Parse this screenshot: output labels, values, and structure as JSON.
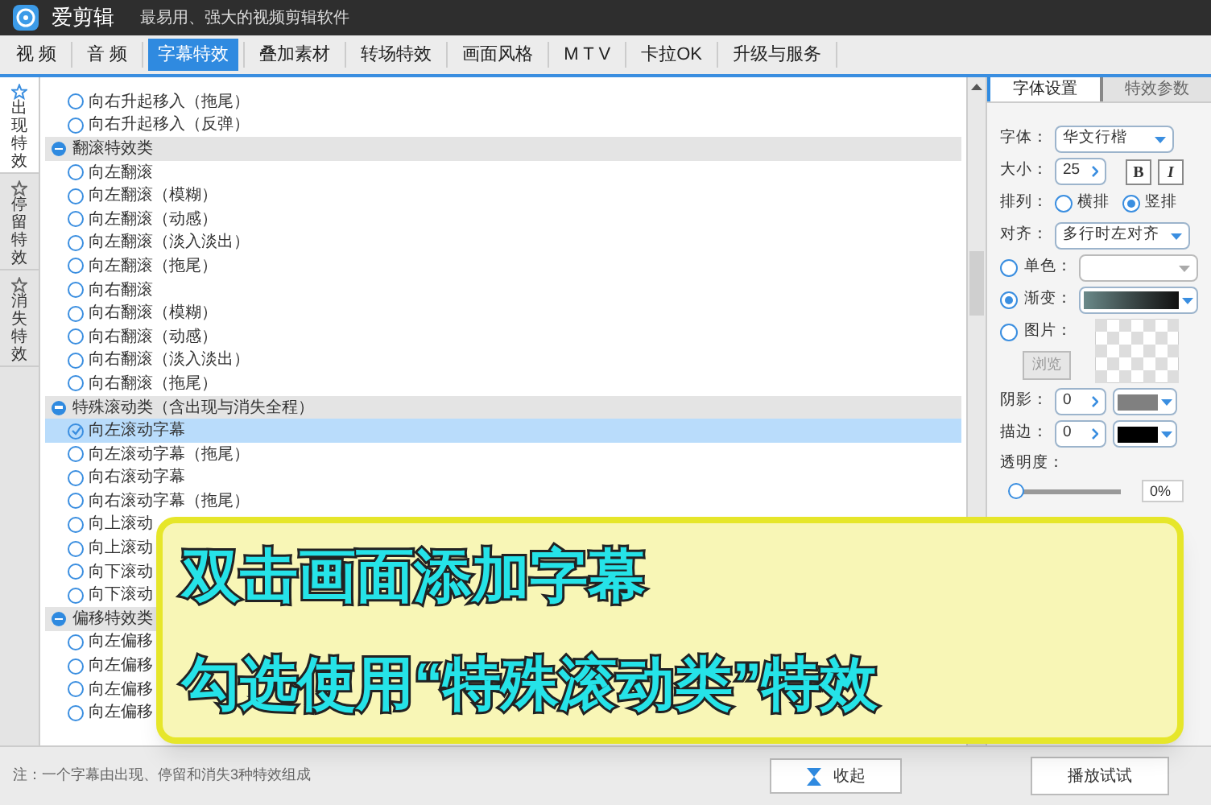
{
  "app": {
    "name": "爱剪辑",
    "slogan": "最易用、强大的视频剪辑软件"
  },
  "tabs": [
    {
      "label": "视 频",
      "selected": false
    },
    {
      "label": "音 频",
      "selected": false
    },
    {
      "label": "字幕特效",
      "selected": true
    },
    {
      "label": "叠加素材",
      "selected": false
    },
    {
      "label": "转场特效",
      "selected": false
    },
    {
      "label": "画面风格",
      "selected": false
    },
    {
      "label": "M T V",
      "selected": false
    },
    {
      "label": "卡拉OK",
      "selected": false
    },
    {
      "label": "升级与服务",
      "selected": false
    }
  ],
  "side_tabs": [
    {
      "label": "出现特效",
      "selected": true
    },
    {
      "label": "停留特效",
      "selected": false
    },
    {
      "label": "消失特效",
      "selected": false
    }
  ],
  "effects": [
    {
      "kind": "item",
      "label": "向右升起移入（拖尾）",
      "selected": false
    },
    {
      "kind": "item",
      "label": "向右升起移入（反弹）",
      "selected": false
    },
    {
      "kind": "group",
      "label": "翻滚特效类"
    },
    {
      "kind": "item",
      "label": "向左翻滚",
      "selected": false
    },
    {
      "kind": "item",
      "label": "向左翻滚（模糊）",
      "selected": false
    },
    {
      "kind": "item",
      "label": "向左翻滚（动感）",
      "selected": false
    },
    {
      "kind": "item",
      "label": "向左翻滚（淡入淡出）",
      "selected": false
    },
    {
      "kind": "item",
      "label": "向左翻滚（拖尾）",
      "selected": false
    },
    {
      "kind": "item",
      "label": "向右翻滚",
      "selected": false
    },
    {
      "kind": "item",
      "label": "向右翻滚（模糊）",
      "selected": false
    },
    {
      "kind": "item",
      "label": "向右翻滚（动感）",
      "selected": false
    },
    {
      "kind": "item",
      "label": "向右翻滚（淡入淡出）",
      "selected": false
    },
    {
      "kind": "item",
      "label": "向右翻滚（拖尾）",
      "selected": false
    },
    {
      "kind": "group",
      "label": "特殊滚动类（含出现与消失全程）"
    },
    {
      "kind": "item",
      "label": "向左滚动字幕",
      "selected": true
    },
    {
      "kind": "item",
      "label": "向左滚动字幕（拖尾）",
      "selected": false
    },
    {
      "kind": "item",
      "label": "向右滚动字幕",
      "selected": false
    },
    {
      "kind": "item",
      "label": "向右滚动字幕（拖尾）",
      "selected": false
    },
    {
      "kind": "item",
      "label": "向上滚动",
      "selected": false
    },
    {
      "kind": "item",
      "label": "向上滚动",
      "selected": false
    },
    {
      "kind": "item",
      "label": "向下滚动",
      "selected": false
    },
    {
      "kind": "item",
      "label": "向下滚动",
      "selected": false
    },
    {
      "kind": "group",
      "label": "偏移特效类"
    },
    {
      "kind": "item",
      "label": "向左偏移",
      "selected": false
    },
    {
      "kind": "item",
      "label": "向左偏移",
      "selected": false
    },
    {
      "kind": "item",
      "label": "向左偏移",
      "selected": false
    },
    {
      "kind": "item",
      "label": "向左偏移",
      "selected": false
    }
  ],
  "panel": {
    "tabs": [
      {
        "label": "字体设置",
        "selected": true
      },
      {
        "label": "特效参数",
        "selected": false
      }
    ],
    "font": {
      "label": "字体：",
      "value": "华文行楷"
    },
    "size": {
      "label": "大小：",
      "value": "25",
      "bold": "B",
      "italic": "I"
    },
    "layout": {
      "label": "排列：",
      "options": [
        {
          "label": "横排",
          "selected": false
        },
        {
          "label": "竖排",
          "selected": true
        }
      ]
    },
    "align": {
      "label": "对齐：",
      "value": "多行时左对齐"
    },
    "fill": [
      {
        "kind": "solid",
        "label": "单色：",
        "selected": false
      },
      {
        "kind": "gradient",
        "label": "渐变：",
        "selected": true
      },
      {
        "kind": "image",
        "label": "图片：",
        "selected": false
      }
    ],
    "browse": {
      "label": "浏览",
      "disabled": true
    },
    "shadow": {
      "label": "阴影：",
      "value": "0",
      "color": "#808080"
    },
    "stroke": {
      "label": "描边：",
      "value": "0",
      "color": "#000000"
    },
    "opacity": {
      "label": "透明度：",
      "level": 0,
      "reading": "0%"
    }
  },
  "note": "注：一个字幕由出现、停留和消失3种特效组成",
  "collapse_button": "收起",
  "play_button": "播放试试",
  "callout": {
    "lines": [
      "双击画面添加字幕",
      "勾选使用“特殊滚动类”特效"
    ]
  }
}
